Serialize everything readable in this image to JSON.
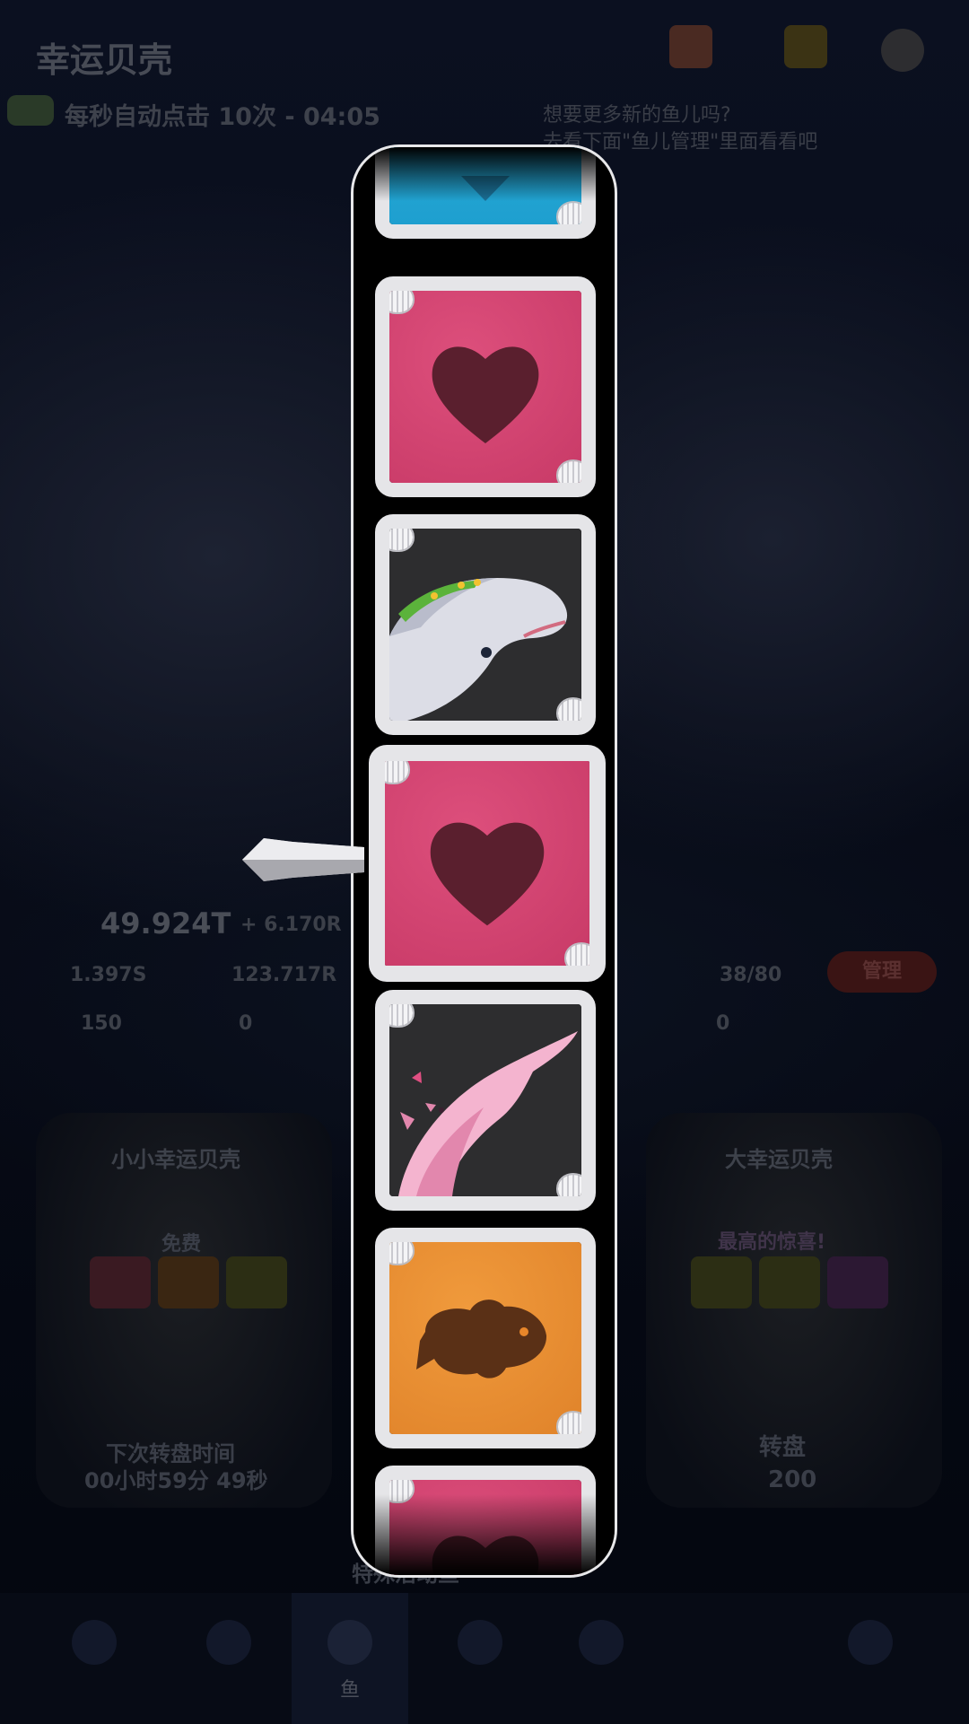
{
  "header": {
    "title": "幸运贝壳",
    "auto_click": "每秒自动点击 10次 - 04:05",
    "tip_line1": "想要更多新的鱼儿吗?",
    "tip_line2": "去看下面\"鱼儿管理\"里面看看吧"
  },
  "stats": {
    "currency": "49.924T",
    "currency_rate": "+ 6.170R",
    "taps": "1.397S",
    "coins": "123.717R",
    "level": "150",
    "gems": "0",
    "fish_count": "38/80",
    "manage_label": "管理",
    "tickets": "0"
  },
  "small_shell": {
    "title": "小小幸运贝壳",
    "badge": "免费",
    "next_spin_label": "下次转盘时间",
    "next_spin_time": "00小时59分 49秒"
  },
  "big_shell": {
    "title": "大幸运贝壳",
    "badge": "最高的惊喜!",
    "spin_label": "转盘",
    "cost": "200"
  },
  "footer_hint": "特殊活动鱼",
  "nav": {
    "tabs": [
      {
        "label": "",
        "icon": "shop-icon"
      },
      {
        "label": "",
        "icon": "upgrade-icon"
      },
      {
        "label": "鱼",
        "icon": "fish-icon",
        "active": true
      },
      {
        "label": "",
        "icon": "decor-icon"
      },
      {
        "label": "",
        "icon": "quest-icon"
      },
      {
        "label": "",
        "icon": "event-icon"
      }
    ]
  },
  "reel": {
    "symbols": [
      "blue-gem",
      "heart",
      "white-whale",
      "heart",
      "pink-dolphin",
      "clownfish",
      "heart"
    ],
    "selected_index": 3
  },
  "colors": {
    "heart_tile": "#d6476f",
    "fish_tile": "#e88d30",
    "gem_tile": "#2aaedb",
    "frame": "#e8e8ea",
    "symbol_dark": "#5a1f2e"
  }
}
